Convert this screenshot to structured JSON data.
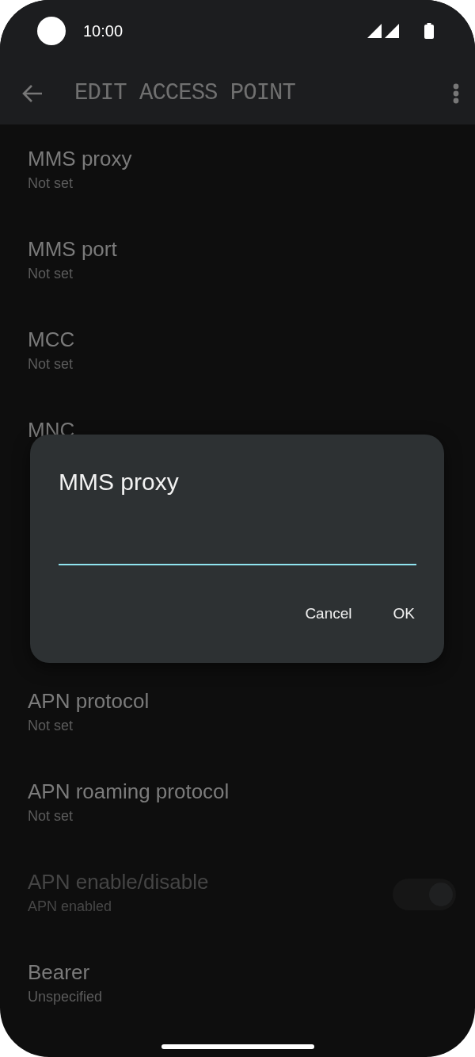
{
  "status_bar": {
    "time": "10:00"
  },
  "app_bar": {
    "title": "EDIT ACCESS POINT"
  },
  "items": [
    {
      "kind": "text",
      "title": "MMS proxy",
      "subtitle": "Not set",
      "disabled": false
    },
    {
      "kind": "text",
      "title": "MMS port",
      "subtitle": "Not set",
      "disabled": false
    },
    {
      "kind": "text",
      "title": "MCC",
      "subtitle": "Not set",
      "disabled": false
    },
    {
      "kind": "text",
      "title": "MNC",
      "disabled": false
    }
  ],
  "items_below": [
    {
      "kind": "text",
      "title": "APN protocol",
      "subtitle": "Not set",
      "disabled": false
    },
    {
      "kind": "text",
      "title": "APN roaming protocol",
      "subtitle": "Not set",
      "disabled": false
    },
    {
      "kind": "toggle",
      "title": "APN enable/disable",
      "subtitle": "APN enabled",
      "disabled": true,
      "on": true
    },
    {
      "kind": "text",
      "title": "Bearer",
      "subtitle": "Unspecified",
      "disabled": false
    }
  ],
  "dialog": {
    "title": "MMS proxy",
    "buttons": [
      "Cancel",
      "OK"
    ]
  }
}
